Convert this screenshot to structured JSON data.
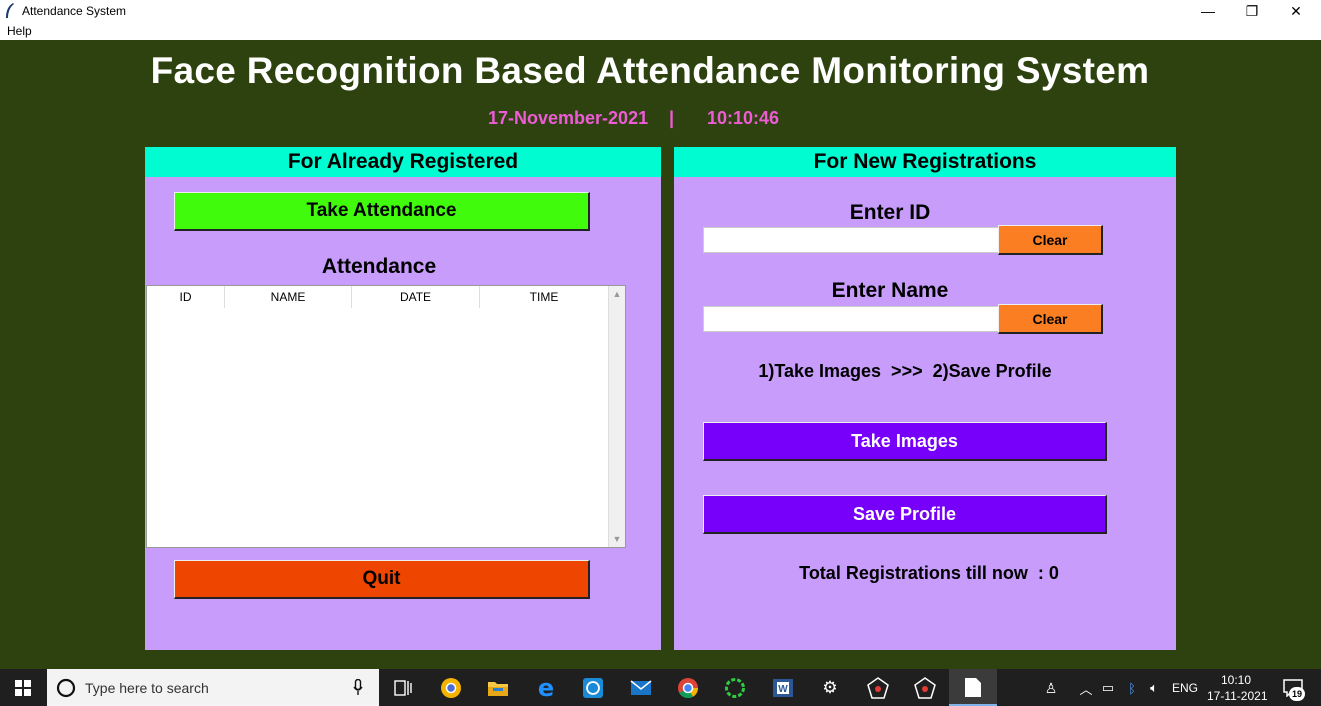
{
  "window": {
    "title": "Attendance System",
    "menu": [
      "Help"
    ],
    "minimize": "—",
    "restore": "❐",
    "close": "✕"
  },
  "header": {
    "title": "Face Recognition Based Attendance Monitoring System",
    "date": "17-November-2021",
    "separator": "|",
    "time": "10:10:46",
    "date_color": "#ee5bd6"
  },
  "left_panel": {
    "heading": "For Already Registered",
    "take_attendance": "Take Attendance",
    "attendance_label": "Attendance",
    "columns": [
      "ID",
      "NAME",
      "DATE",
      "TIME"
    ],
    "rows": [],
    "quit": "Quit"
  },
  "right_panel": {
    "heading": "For New Registrations",
    "enter_id": "Enter ID",
    "id_value": "",
    "clear_id": "Clear",
    "enter_name": "Enter Name",
    "name_value": "",
    "clear_name": "Clear",
    "instructions": "1)Take Images  >>>  2)Save Profile",
    "take_images": "Take Images",
    "save_profile": "Save Profile",
    "total_registrations": "Total Registrations till now  : 0"
  },
  "colors": {
    "background": "#2d420e",
    "panel": "#c79cfb",
    "panel_head": "#00fcd0",
    "take_attendance": "#40fb0c",
    "quit": "#ee4500",
    "clear": "#fb7e22",
    "purple_button": "#7700fb"
  },
  "taskbar": {
    "search_placeholder": "Type here to search",
    "icons": [
      "windows-start-icon",
      "microphone-icon",
      "task-view-icon",
      "chrome-canary-icon",
      "file-explorer-icon",
      "edge-icon",
      "sync-icon",
      "mail-icon",
      "chrome-icon",
      "app-ring-icon",
      "word-icon",
      "settings-icon",
      "spider-app-icon",
      "spider-app-icon",
      "notepad-icon"
    ],
    "language": "ENG",
    "clock_time": "10:10",
    "clock_date": "17-11-2021",
    "notification_count": "19"
  }
}
